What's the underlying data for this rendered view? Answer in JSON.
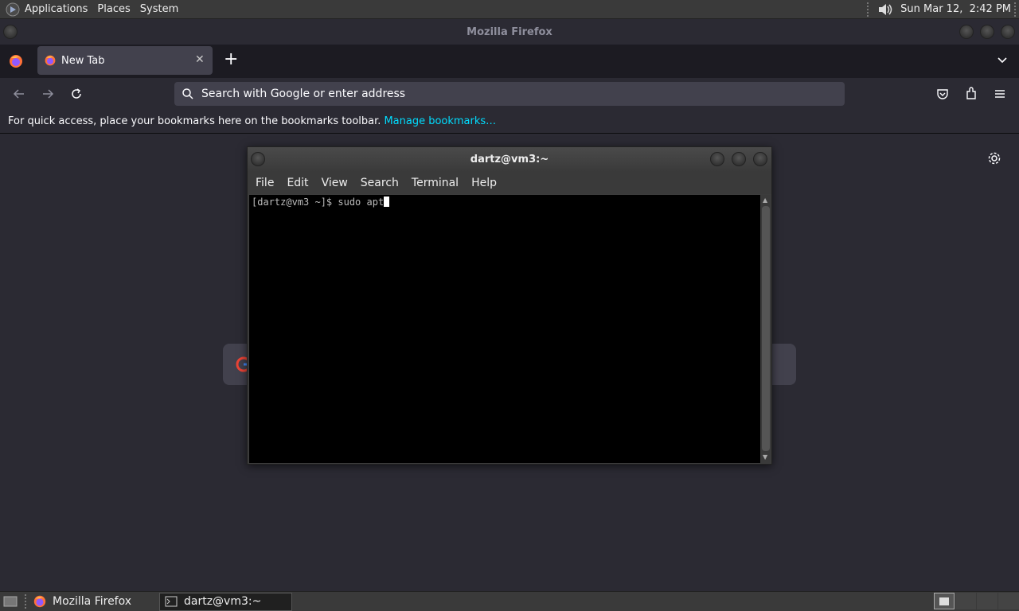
{
  "top_panel": {
    "menus": [
      "Applications",
      "Places",
      "System"
    ],
    "clock": "Sun Mar 12,  2:42 PM"
  },
  "firefox": {
    "window_title": "Mozilla Firefox",
    "tab_label": "New Tab",
    "url_placeholder": "Search with Google or enter address",
    "bookmarks_text": "For quick access, place your bookmarks here on the bookmarks toolbar.",
    "bookmarks_link": "Manage bookmarks…"
  },
  "terminal": {
    "title": "dartz@vm3:~",
    "menu": [
      "File",
      "Edit",
      "View",
      "Search",
      "Terminal",
      "Help"
    ],
    "prompt": "[dartz@vm3 ~]$ ",
    "command": "sudo apt"
  },
  "taskbar": {
    "tasks": [
      "Mozilla Firefox",
      "dartz@vm3:~"
    ]
  },
  "colors": {
    "firefox_dark": "#2b2a33",
    "link": "#00ddff",
    "terminal_bg": "#000000"
  }
}
